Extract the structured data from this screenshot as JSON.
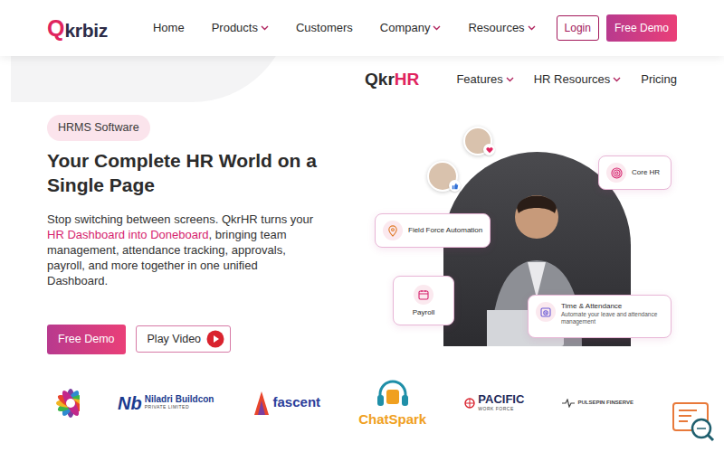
{
  "brand": {
    "mark": "Q",
    "name": "krbiz"
  },
  "nav": {
    "items": [
      {
        "label": "Home",
        "dropdown": false
      },
      {
        "label": "Products",
        "dropdown": true
      },
      {
        "label": "Customers",
        "dropdown": false
      },
      {
        "label": "Company",
        "dropdown": true
      },
      {
        "label": "Resources",
        "dropdown": true
      }
    ],
    "login": "Login",
    "demo": "Free Demo"
  },
  "subnav": {
    "prefix": "Qkr",
    "accent": "HR",
    "items": [
      {
        "label": "Features",
        "dropdown": true
      },
      {
        "label": "HR Resources",
        "dropdown": true
      },
      {
        "label": "Pricing",
        "dropdown": false
      }
    ]
  },
  "hero": {
    "badge": "HRMS Software",
    "title": "Your Complete HR World on a Single Page",
    "intro_before": "Stop switching between screens. QkrHR turns your ",
    "intro_highlight": "HR Dashboard into Doneboard",
    "intro_after": ", bringing team management, attendance tracking, approvals, payroll, and more together in one unified Dashboard.",
    "demo_button": "Free Demo",
    "video_button": "Play Video"
  },
  "features": [
    {
      "label": "Core HR",
      "description": "",
      "kind": "fingerprint"
    },
    {
      "label": "Field Force Automation",
      "description": "",
      "kind": "location"
    },
    {
      "label": "Payroll",
      "description": "",
      "kind": "calendar"
    },
    {
      "label": "Time & Attendance",
      "description": "Automate your leave and attendance management",
      "kind": "clock"
    }
  ],
  "clients": [
    {
      "mark": "Nb",
      "name": "Niladri Buildcon",
      "sub": "PRIVATE LIMITED",
      "color": "#1b3b8f"
    },
    {
      "mark": "",
      "name": "fascent",
      "sub": "",
      "color": "#2b3d9a"
    },
    {
      "mark": "",
      "name": "ChatSpark",
      "sub": "",
      "color": "#f0a020"
    },
    {
      "mark": "",
      "name": "PACIFIC",
      "sub": "WORK FORCE",
      "color": "#1f2a5a"
    },
    {
      "mark": "",
      "name": "PULSEPIN FINSERVE",
      "sub": "",
      "color": "#444444"
    }
  ]
}
